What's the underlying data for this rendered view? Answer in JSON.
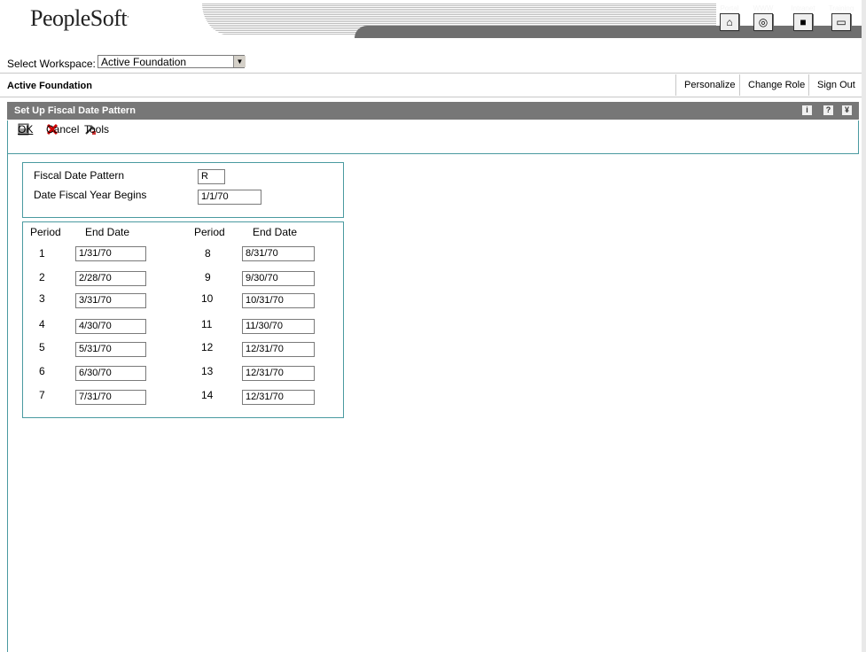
{
  "header": {
    "logo_text": "PeopleSoft",
    "logo_mark": ".",
    "nav": [
      {
        "label": "Portal",
        "icon": "home-icon",
        "glyph": "⌂"
      },
      {
        "label": "WWW",
        "icon": "globe-icon",
        "glyph": "◎"
      },
      {
        "label": "Intranet",
        "icon": "book-icon",
        "glyph": "■"
      },
      {
        "label": "Training",
        "icon": "monitor-icon",
        "glyph": "▭"
      }
    ]
  },
  "workspace": {
    "label": "Select Workspace:",
    "value": "Active Foundation"
  },
  "titlebar": {
    "title": "Active Foundation",
    "links": [
      "Personalize",
      "Change Role",
      "Sign Out"
    ]
  },
  "form": {
    "title": "Set Up Fiscal Date Pattern",
    "toolbar": {
      "ok": "OK",
      "cancel": "Cancel",
      "tools": "Tools"
    },
    "pattern_label": "Fiscal Date Pattern",
    "pattern_value": "R",
    "begin_label": "Date Fiscal Year Begins",
    "begin_value": "1/1/70",
    "col_period": "Period",
    "col_end_date": "End Date",
    "periods": [
      {
        "period": "1",
        "end_date": "1/31/70"
      },
      {
        "period": "2",
        "end_date": "2/28/70"
      },
      {
        "period": "3",
        "end_date": "3/31/70"
      },
      {
        "period": "4",
        "end_date": "4/30/70"
      },
      {
        "period": "5",
        "end_date": "5/31/70"
      },
      {
        "period": "6",
        "end_date": "6/30/70"
      },
      {
        "period": "7",
        "end_date": "7/31/70"
      },
      {
        "period": "8",
        "end_date": "8/31/70"
      },
      {
        "period": "9",
        "end_date": "9/30/70"
      },
      {
        "period": "10",
        "end_date": "10/31/70"
      },
      {
        "period": "11",
        "end_date": "11/30/70"
      },
      {
        "period": "12",
        "end_date": "12/31/70"
      },
      {
        "period": "13",
        "end_date": "12/31/70"
      },
      {
        "period": "14",
        "end_date": "12/31/70"
      }
    ]
  },
  "colors": {
    "accent": "#4a9aa0",
    "titlebar": "#777777"
  }
}
